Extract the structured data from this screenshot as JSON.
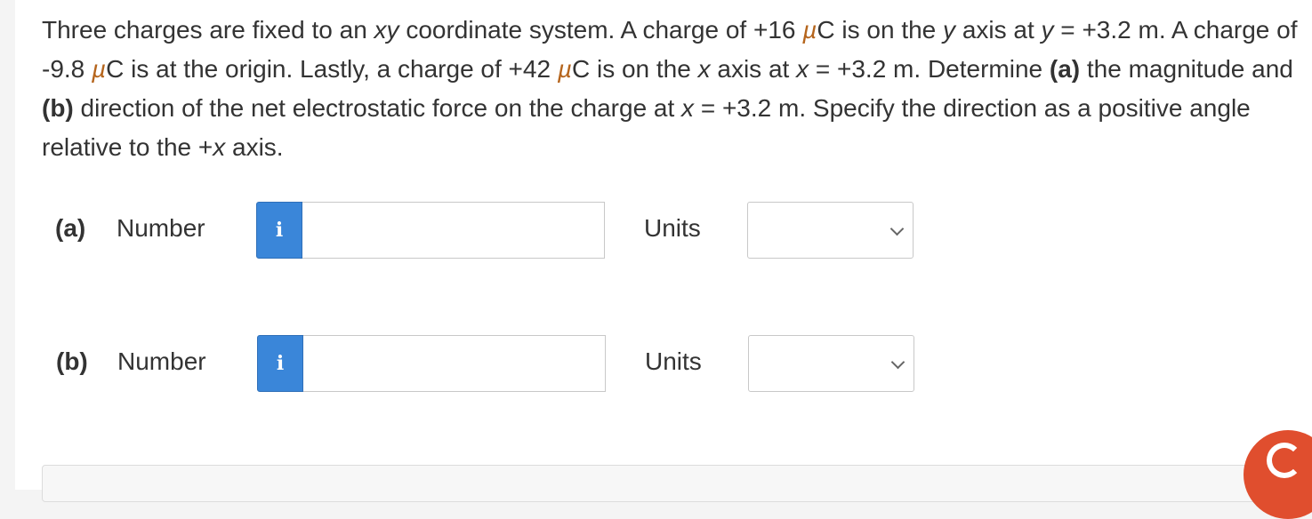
{
  "problem": {
    "s1": "Three charges are fixed to an ",
    "s1_italic": "xy",
    "s2": " coordinate system. A charge of +16 ",
    "mu1": "µ",
    "s3": "C is on the ",
    "s3_italic": "y",
    "s4": " axis at ",
    "s4_italic": "y",
    "s5": " = +3.2 m. A charge of -9.8 ",
    "mu2": "µ",
    "s6": "C is at the origin. Lastly, a charge of +42 ",
    "mu3": "µ",
    "s7": "C is on the ",
    "s7_italic": "x",
    "s8": " axis at ",
    "s8_italic": "x",
    "s9": " = +3.2 m. Determine ",
    "bold_a": "(a)",
    "s10": " the magnitude and ",
    "bold_b": "(b)",
    "s11": " direction of the net electrostatic force on the charge at ",
    "s11_italic": "x",
    "s12": " = +3.2 m. Specify the direction as a positive angle relative to the +",
    "s12_italic": "x",
    "s13": " axis."
  },
  "answers": [
    {
      "part": "(a)",
      "number_label": "Number",
      "info_icon": "i",
      "value": "",
      "units_label": "Units",
      "units_selected": ""
    },
    {
      "part": "(b)",
      "number_label": "Number",
      "info_icon": "i",
      "value": "",
      "units_label": "Units",
      "units_selected": ""
    }
  ],
  "colors": {
    "info_button": "#3a86d9",
    "help_badge": "#e04e2e",
    "text": "#333333"
  }
}
